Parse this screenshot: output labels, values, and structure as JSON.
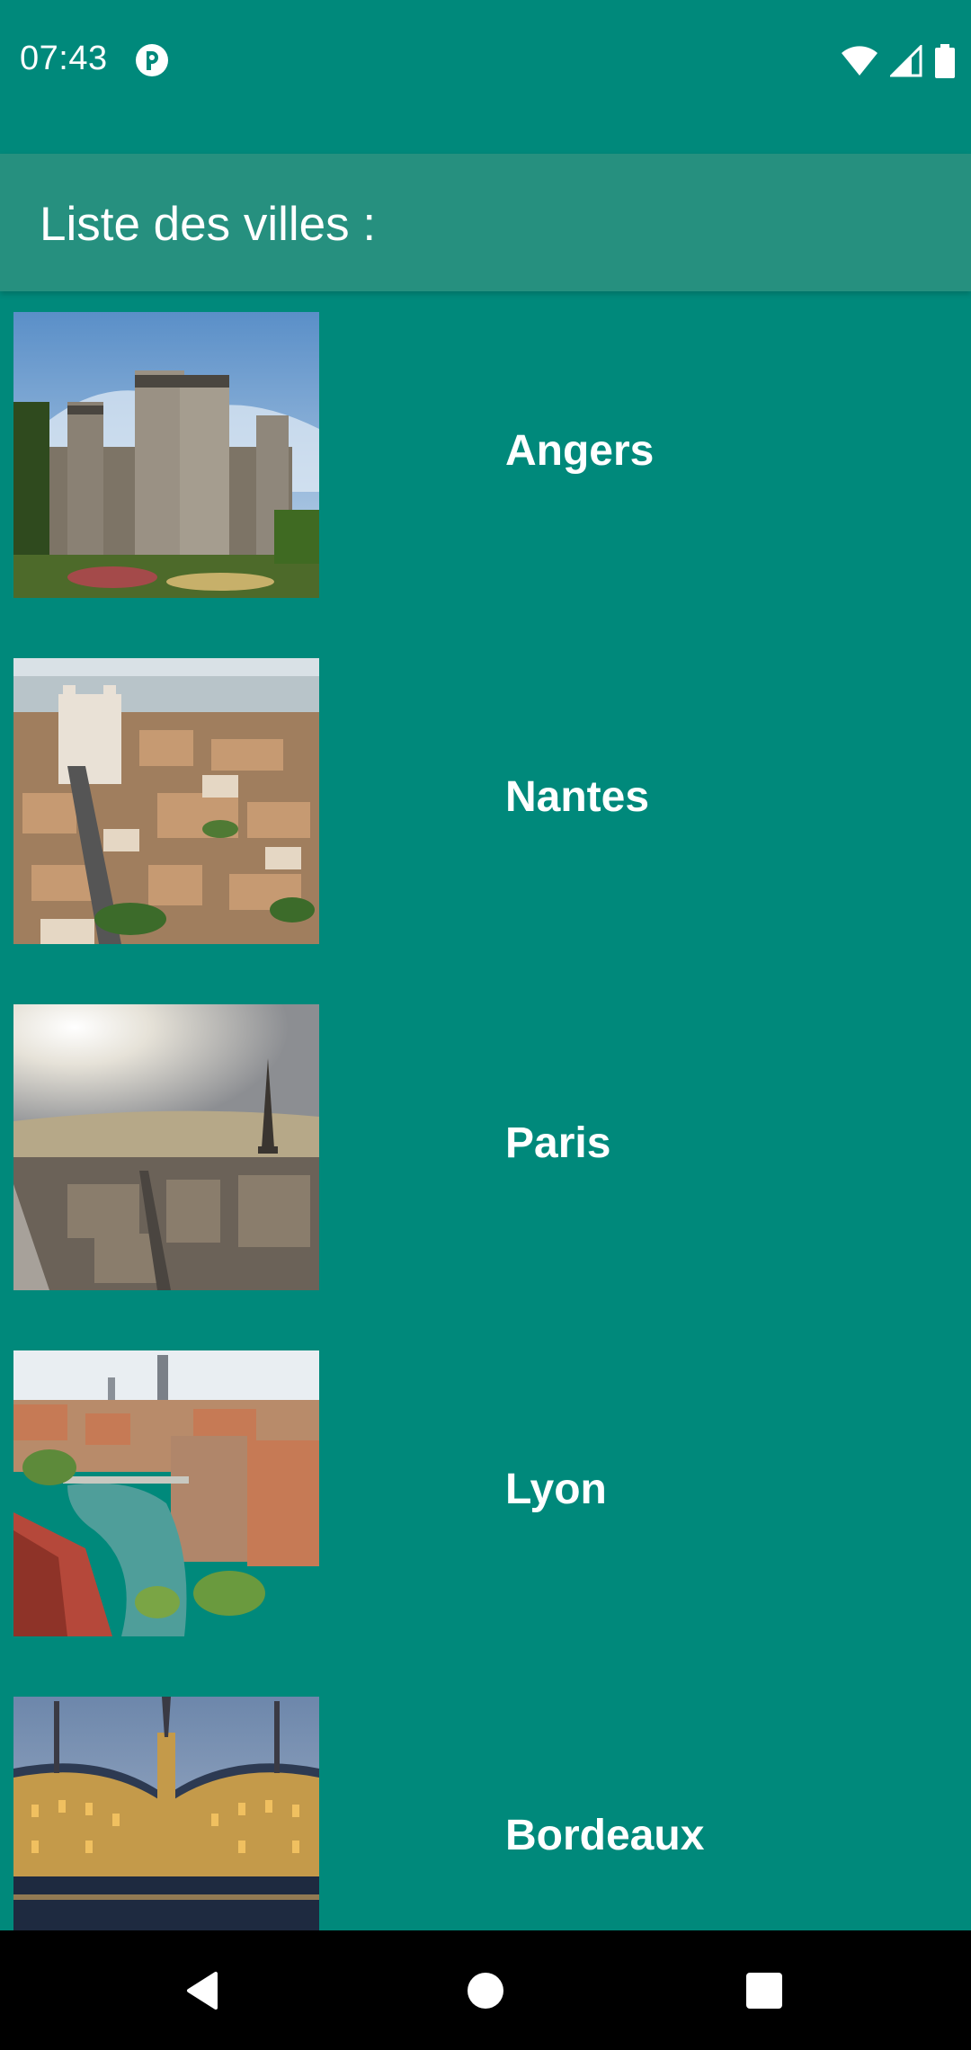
{
  "status_bar": {
    "time": "07:43",
    "icons": [
      "app-notification-icon",
      "wifi-icon",
      "cellular-signal-icon",
      "battery-icon"
    ]
  },
  "app_bar": {
    "title": "Liste des villes :"
  },
  "cities": [
    {
      "name": "Angers",
      "image": "angers-castle-photo"
    },
    {
      "name": "Nantes",
      "image": "nantes-cityscape-photo"
    },
    {
      "name": "Paris",
      "image": "paris-skyline-photo"
    },
    {
      "name": "Lyon",
      "image": "lyon-riverside-photo"
    },
    {
      "name": "Bordeaux",
      "image": "bordeaux-place-de-la-bourse-photo"
    }
  ],
  "nav_bar": {
    "buttons": [
      "back-icon",
      "home-icon",
      "recents-icon"
    ]
  },
  "colors": {
    "background": "#00897B",
    "app_bar": "#26907F",
    "text": "#FFFFFF",
    "nav_bar": "#000000"
  }
}
